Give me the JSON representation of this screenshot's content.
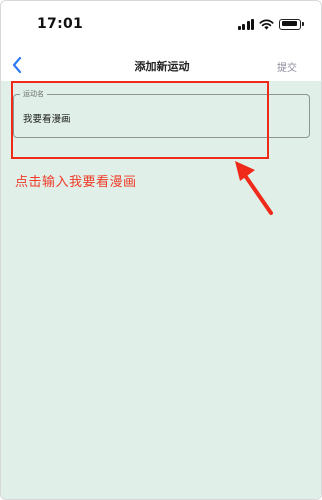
{
  "status_bar": {
    "time": "17:01"
  },
  "nav": {
    "title": "添加新运动",
    "submit_label": "提交"
  },
  "form": {
    "name_field": {
      "label": "运动名",
      "value": "我要看漫画"
    }
  },
  "annotation": {
    "text": "点击输入我要看漫画",
    "color": "#ef2a1a"
  },
  "colors": {
    "content_background": "#e0f0e8",
    "back_icon": "#2f7bf5"
  }
}
